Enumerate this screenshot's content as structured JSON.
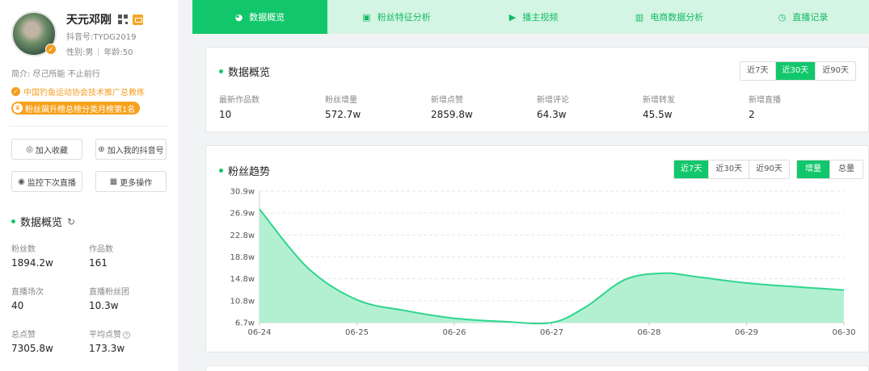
{
  "profile": {
    "name": "天元邓刚",
    "douyin_id": "抖音号:TYDG2019",
    "gender": "性别:男",
    "age": "年龄:50",
    "bio": "简介: 尽己所能 不止前行",
    "honor": "中国钓鱼运动协会技术推广总教练",
    "rank": "粉丝飙升榜总榜分类月榜第1名"
  },
  "actions": {
    "favorite": "加入收藏",
    "add_mine": "加入我的抖音号",
    "monitor_live": "监控下次直播",
    "more": "更多操作"
  },
  "side_overview": {
    "title": "数据概览",
    "stats": [
      {
        "label": "粉丝数",
        "value": "1894.2w"
      },
      {
        "label": "作品数",
        "value": "161"
      },
      {
        "label": "直播场次",
        "value": "40"
      },
      {
        "label": "直播粉丝团",
        "value": "10.3w"
      },
      {
        "label": "总点赞",
        "value": "7305.8w"
      },
      {
        "label": "平均点赞",
        "value": "173.3w"
      }
    ]
  },
  "tabs": [
    {
      "label": "数据概览",
      "icon": "pie-chart-icon"
    },
    {
      "label": "粉丝特征分析",
      "icon": "id-card-icon"
    },
    {
      "label": "播主视频",
      "icon": "video-icon"
    },
    {
      "label": "电商数据分析",
      "icon": "shop-icon"
    },
    {
      "label": "直播记录",
      "icon": "clock-icon"
    }
  ],
  "overview_card": {
    "title": "数据概览",
    "ranges": [
      "近7天",
      "近30天",
      "近90天"
    ],
    "active_range": "近30天",
    "metrics": [
      {
        "label": "最新作品数",
        "value": "10"
      },
      {
        "label": "粉丝增量",
        "value": "572.7w"
      },
      {
        "label": "新增点赞",
        "value": "2859.8w"
      },
      {
        "label": "新增评论",
        "value": "64.3w"
      },
      {
        "label": "新增转发",
        "value": "45.5w"
      },
      {
        "label": "新增直播",
        "value": "2"
      }
    ]
  },
  "trend_card": {
    "title": "粉丝趋势",
    "ranges": [
      "近7天",
      "近30天",
      "近90天"
    ],
    "active_range": "近7天",
    "modes": [
      "增量",
      "总量"
    ],
    "active_mode": "增量"
  },
  "colors": {
    "accent": "#12c76b",
    "tab_bg": "#d4f5e3",
    "area": "#b3f0d2",
    "line": "#2fd58e",
    "orange": "#f39c1f"
  },
  "chart_data": {
    "type": "area",
    "x": [
      "06-24",
      "06-25",
      "06-26",
      "06-27",
      "06-28",
      "06-29",
      "06-30"
    ],
    "y_ticks": [
      "6.7w",
      "10.8w",
      "14.8w",
      "18.8w",
      "22.8w",
      "26.9w",
      "30.9w"
    ],
    "ylim": [
      6.7,
      30.9
    ],
    "curve_points": [
      {
        "x": 0.0,
        "y": 27.6
      },
      {
        "x": 0.5,
        "y": 16.7
      },
      {
        "x": 1.0,
        "y": 10.9
      },
      {
        "x": 1.5,
        "y": 8.9
      },
      {
        "x": 2.0,
        "y": 7.5
      },
      {
        "x": 2.5,
        "y": 6.9
      },
      {
        "x": 3.0,
        "y": 6.7
      },
      {
        "x": 3.35,
        "y": 9.6
      },
      {
        "x": 3.75,
        "y": 14.6
      },
      {
        "x": 4.15,
        "y": 15.8
      },
      {
        "x": 4.5,
        "y": 15.1
      },
      {
        "x": 5.0,
        "y": 14.0
      },
      {
        "x": 5.5,
        "y": 13.3
      },
      {
        "x": 6.0,
        "y": 12.7
      }
    ],
    "grid": true
  }
}
